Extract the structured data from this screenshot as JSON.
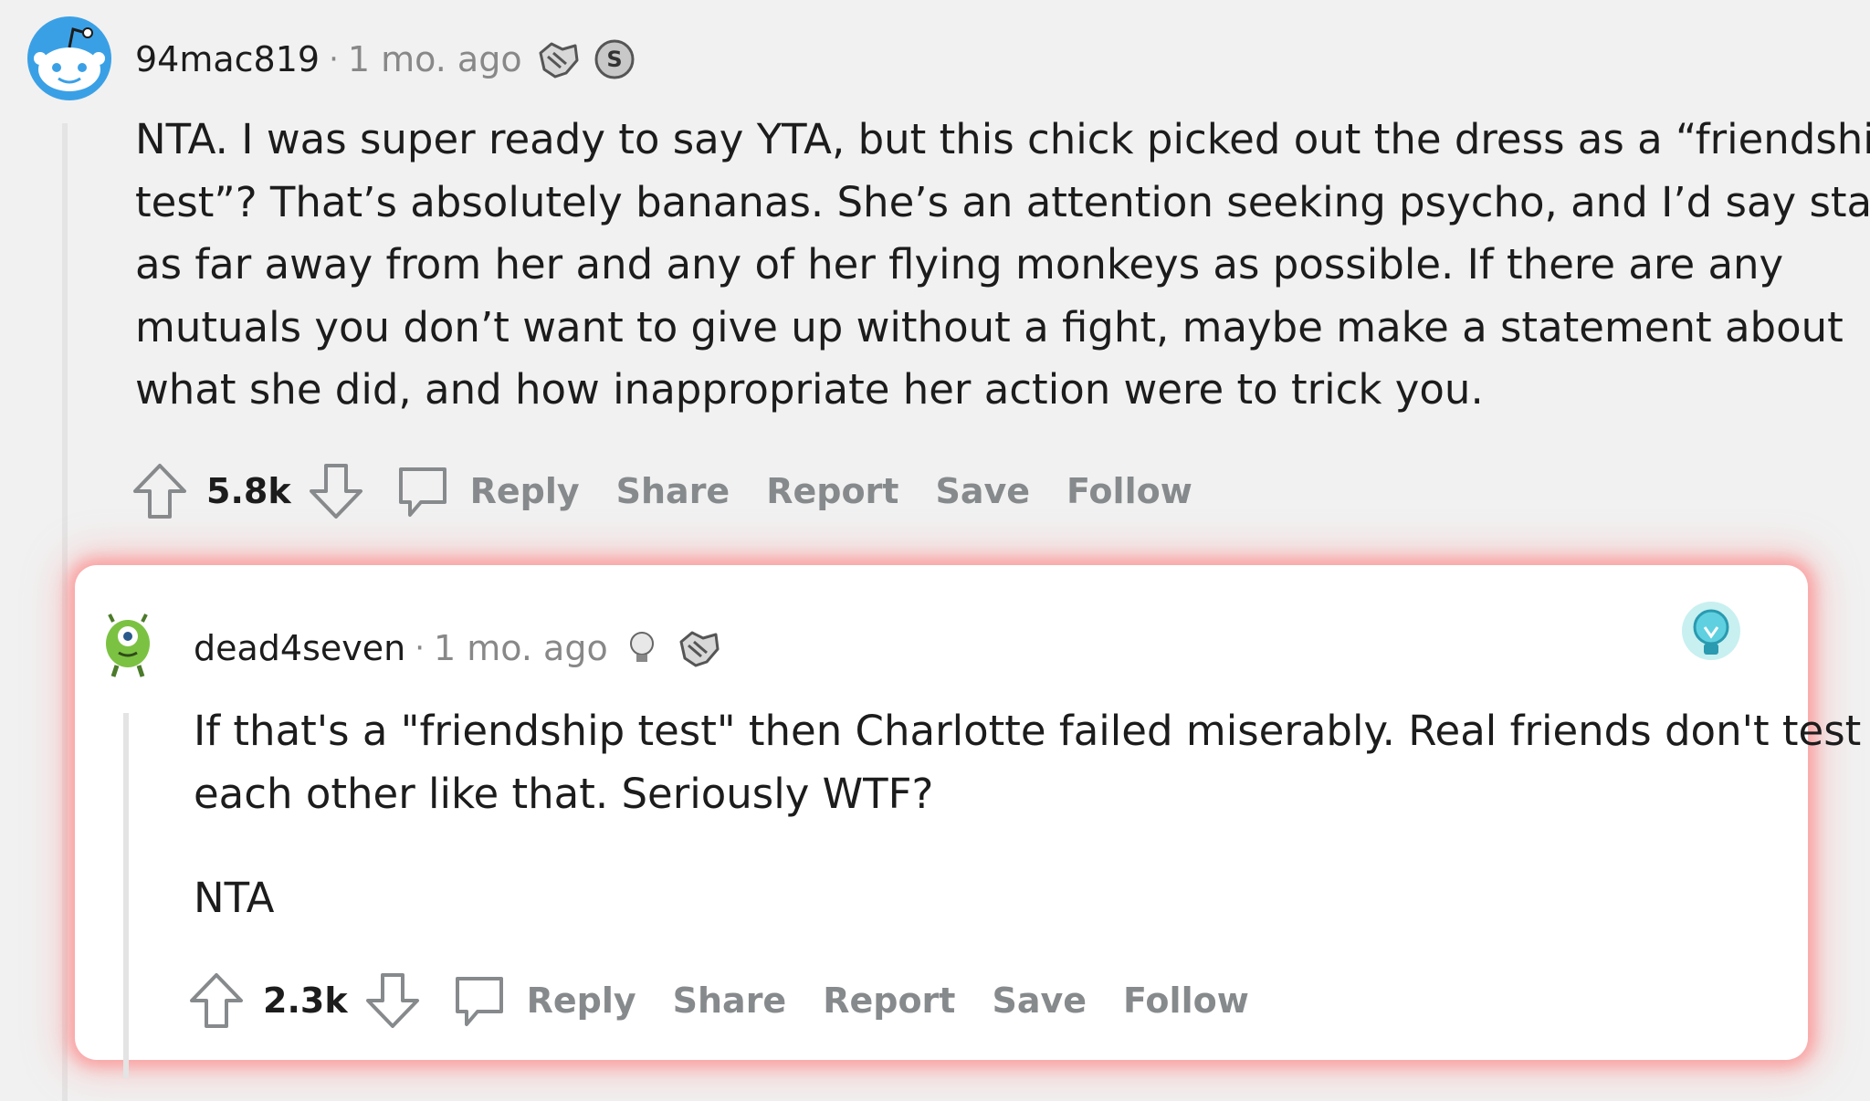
{
  "comments": [
    {
      "username": "94mac819",
      "separator": "·",
      "time": "1 mo. ago",
      "awards": [
        "handshake-award-icon",
        "silver-coin-award-icon"
      ],
      "body_lines": [
        "NTA. I was super ready to say YTA, but this chick picked out the dress as a “friendship",
        "test”? That’s absolutely bananas. She’s an attention seeking psycho, and I’d say stay",
        "as far away from her and any of her flying monkeys as possible. If there are any",
        "mutuals you don’t want to give up without a fight, maybe make a statement about",
        "what she did, and how inappropriate her action were to trick you."
      ],
      "votes": "5.8k",
      "actions": {
        "reply": "Reply",
        "share": "Share",
        "report": "Report",
        "save": "Save",
        "follow": "Follow"
      }
    },
    {
      "username": "dead4seven",
      "separator": "·",
      "time": "1 mo. ago",
      "awards": [
        "lightbulb-award-icon",
        "handshake-award-icon"
      ],
      "body_lines": [
        "If that's a \"friendship test\" then Charlotte failed miserably. Real friends don't test",
        "each other like that. Seriously WTF?"
      ],
      "body_para2": "NTA",
      "votes": "2.3k",
      "actions": {
        "reply": "Reply",
        "share": "Share",
        "report": "Report",
        "save": "Save",
        "follow": "Follow"
      }
    }
  ],
  "colors": {
    "highlight_glow": "#ff8a8a",
    "muted_text": "#878a8c",
    "thread_line": "#e4e4e4"
  }
}
